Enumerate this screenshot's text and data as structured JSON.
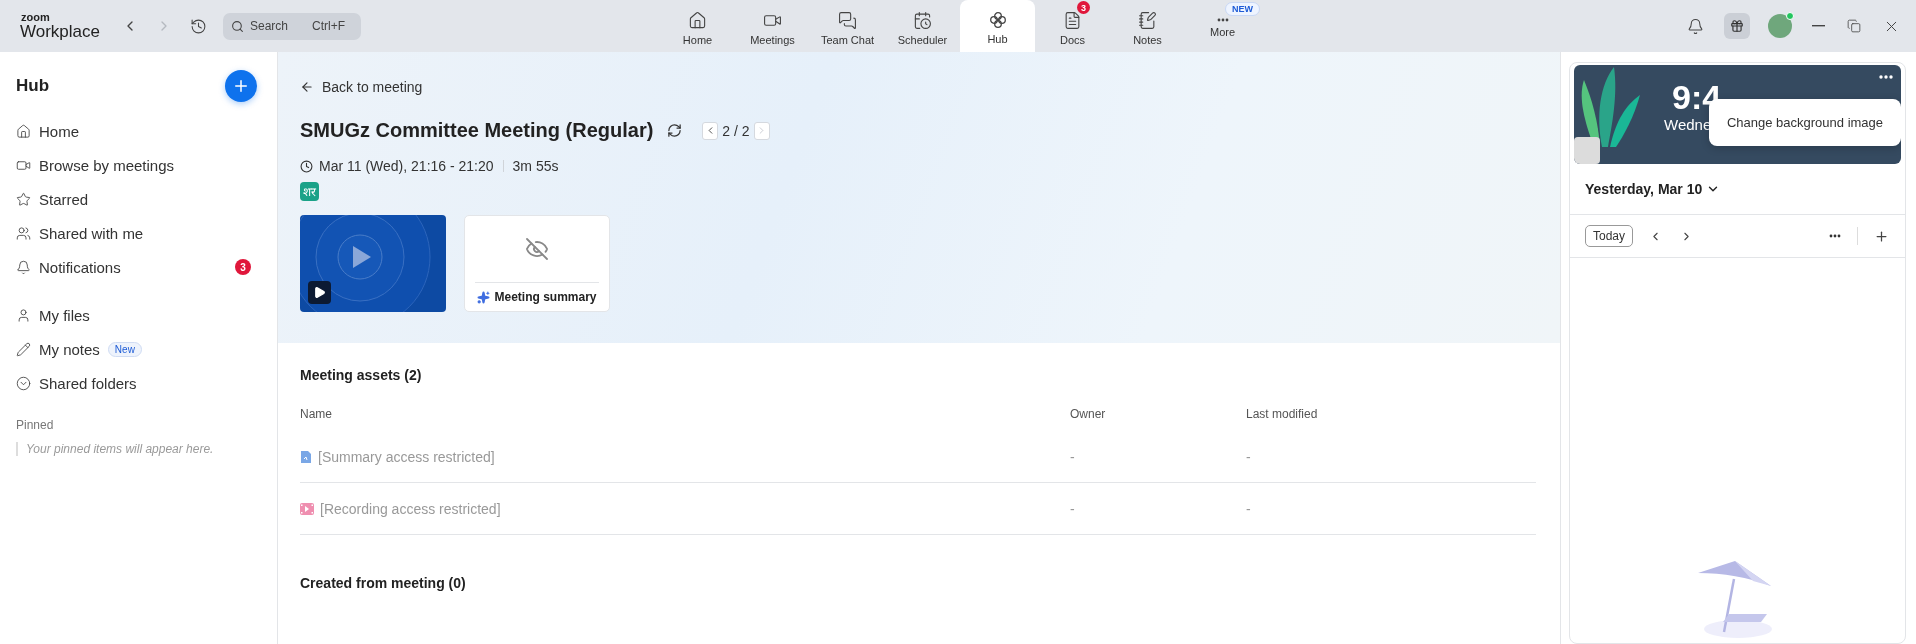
{
  "app": {
    "logo_top": "zoom",
    "logo_bottom": "Workplace"
  },
  "search": {
    "placeholder": "Search",
    "shortcut": "Ctrl+F"
  },
  "nav_tabs": [
    {
      "label": "Home",
      "selected": false
    },
    {
      "label": "Meetings",
      "selected": false
    },
    {
      "label": "Team Chat",
      "selected": false
    },
    {
      "label": "Scheduler",
      "selected": false
    },
    {
      "label": "Hub",
      "selected": true
    },
    {
      "label": "Docs",
      "selected": false,
      "badge": "3"
    },
    {
      "label": "Notes",
      "selected": false
    },
    {
      "label": "More",
      "selected": false,
      "tag": "NEW"
    }
  ],
  "sidebar": {
    "title": "Hub",
    "groups": [
      [
        {
          "label": "Home",
          "selected": false
        },
        {
          "label": "Browse by meetings",
          "selected": false
        },
        {
          "label": "Starred",
          "selected": false
        },
        {
          "label": "Shared with me",
          "selected": false
        },
        {
          "label": "Notifications",
          "selected": false,
          "badge": "3"
        }
      ],
      [
        {
          "label": "My files",
          "selected": false
        },
        {
          "label": "My notes",
          "selected": false,
          "tag": "New"
        },
        {
          "label": "Shared folders",
          "selected": false
        }
      ]
    ],
    "pinned_heading": "Pinned",
    "pinned_empty": "Your pinned items will appear here."
  },
  "meeting": {
    "back": "Back to meeting",
    "title": "SMUGz Committee Meeting (Regular)",
    "pager": "2 / 2",
    "prev_disabled": false,
    "next_disabled": true,
    "date": "Mar 11 (Wed), 21:16 - 21:20",
    "duration": "3m 55s",
    "tag": "शर",
    "cards": [
      {
        "kind": "recording"
      },
      {
        "kind": "summary",
        "label": "Meeting summary"
      }
    ]
  },
  "assets": {
    "heading": "Meeting assets (2)",
    "columns": [
      "Name",
      "Owner",
      "Last modified"
    ],
    "rows": [
      {
        "kind": "summary",
        "name": "[Summary access restricted]",
        "owner": "-",
        "modified": "-"
      },
      {
        "kind": "recording",
        "name": "[Recording access restricted]",
        "owner": "-",
        "modified": "-"
      }
    ]
  },
  "created": {
    "heading": "Created from meeting (0)"
  },
  "calendar": {
    "time": "9:4",
    "day": "Wedne",
    "tooltip": "Change background image",
    "date": "Yesterday, Mar 10",
    "today": "Today"
  }
}
